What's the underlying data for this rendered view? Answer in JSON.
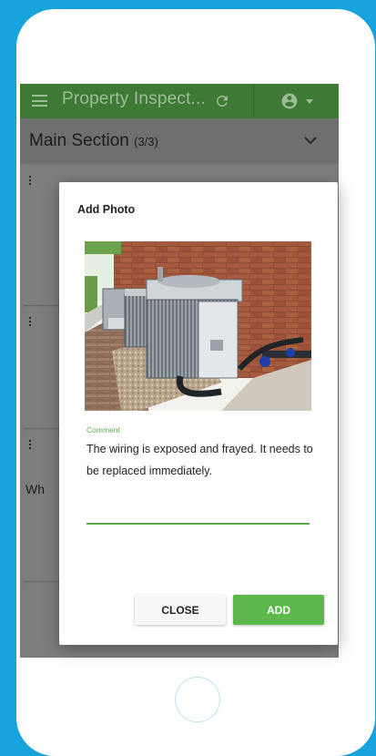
{
  "app": {
    "title": "Property Inspect...",
    "icons": {
      "menu": "hamburger-menu-icon",
      "refresh": "refresh-icon",
      "account": "account-circle-icon",
      "dropdown": "caret-down-icon"
    }
  },
  "section": {
    "title": "Main Section",
    "count": "(3/3)"
  },
  "background_partial_text": "Wh",
  "dialog": {
    "title": "Add Photo",
    "comment_label": "Comment",
    "comment_value": "The wiring is exposed and frayed. It needs to be replaced immediately.",
    "close_label": "CLOSE",
    "add_label": "ADD"
  },
  "colors": {
    "page_bg": "#17a3dc",
    "appbar": "#3e7a36",
    "accent": "#5cb84a"
  }
}
